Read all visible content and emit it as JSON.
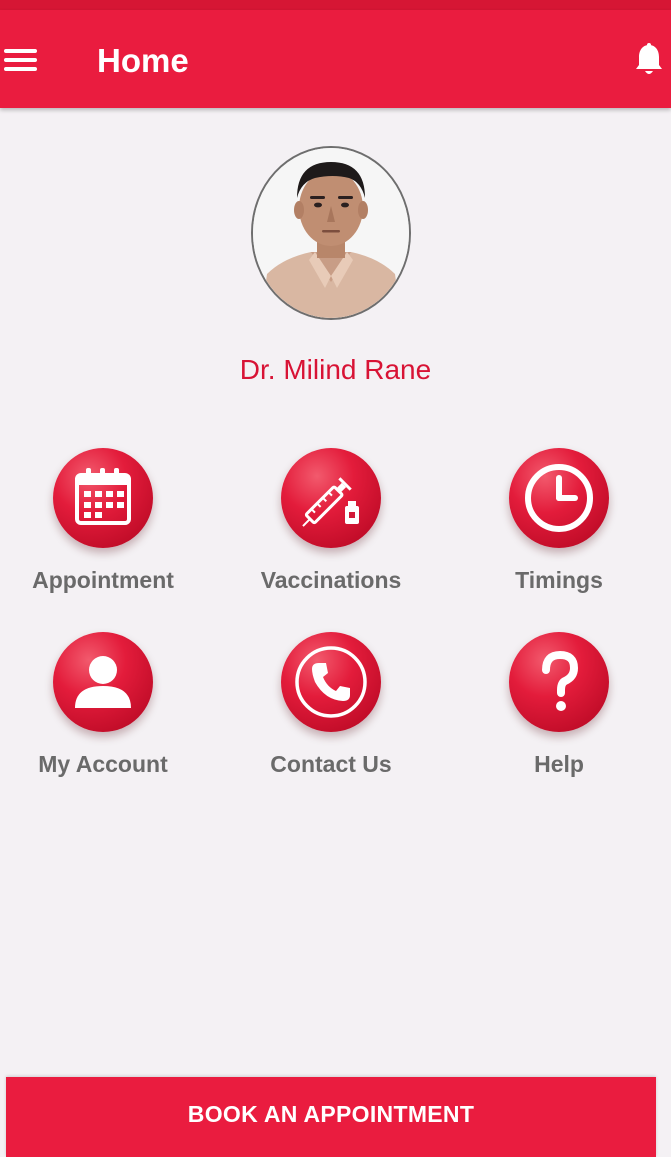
{
  "app_bar": {
    "title": "Home",
    "menu_icon": "hamburger-menu-icon",
    "notification_icon": "bell-icon",
    "color": "#ea1c3f"
  },
  "profile": {
    "doctor_name": "Dr. Milind Rane",
    "name_color": "#d81335"
  },
  "grid": {
    "items": [
      {
        "label": "Appointment",
        "icon": "calendar-icon"
      },
      {
        "label": "Vaccinations",
        "icon": "syringe-icon"
      },
      {
        "label": "Timings",
        "icon": "clock-icon"
      },
      {
        "label": "My Account",
        "icon": "user-icon"
      },
      {
        "label": "Contact Us",
        "icon": "phone-icon"
      },
      {
        "label": "Help",
        "icon": "question-mark-icon"
      }
    ]
  },
  "footer": {
    "book_label": "BOOK AN APPOINTMENT"
  }
}
